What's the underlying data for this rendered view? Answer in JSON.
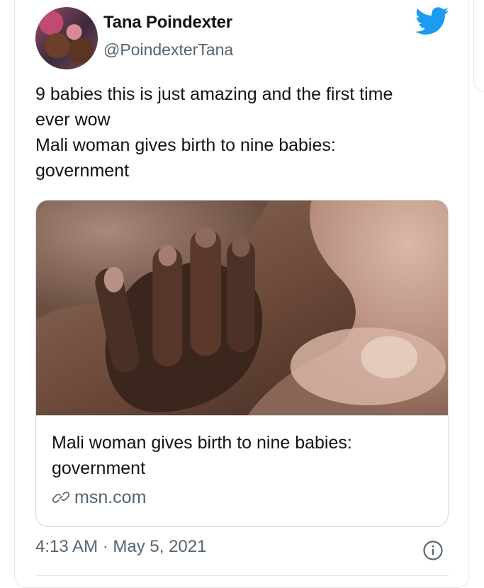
{
  "author": {
    "name": "Tana Poindexter",
    "handle": "@PoindexterTana"
  },
  "tweet": {
    "text": "9 babies this is just amazing and the first time\never wow\nMali woman gives birth to nine babies:\ngovernment",
    "timestamp": "4:13 AM · May 5, 2021"
  },
  "link_card": {
    "title": "Mali woman gives birth to nine babies:\ngovernment",
    "domain": "msn.com"
  },
  "icons": {
    "brand": "twitter-bird-icon",
    "link": "link-icon",
    "info": "info-icon"
  },
  "colors": {
    "twitter_blue": "#1d9bf0",
    "secondary_text": "#536471",
    "border": "#cfd9de"
  }
}
